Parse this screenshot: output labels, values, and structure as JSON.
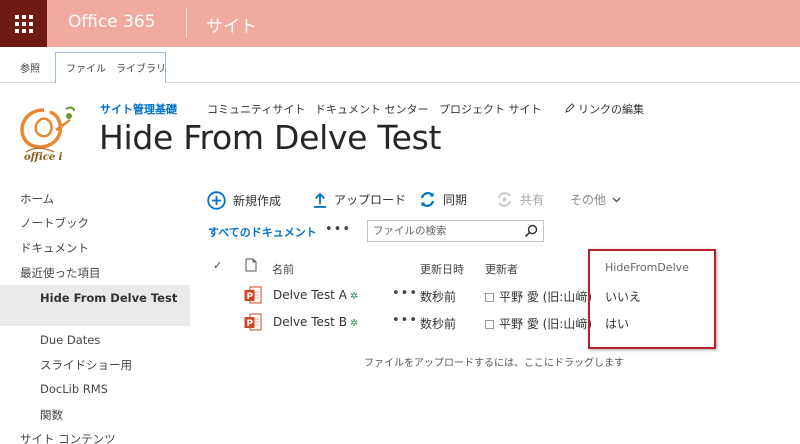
{
  "suite": {
    "brand": "Office 365",
    "site": "サイト"
  },
  "ribbon": {
    "tabs": [
      "参照",
      "ファイル",
      "ライブラリ"
    ]
  },
  "topnav": {
    "items": [
      "サイト管理基礎",
      "コミュニティサイト",
      "ドキュメント センター",
      "プロジェクト サイト"
    ],
    "edit_links": "リンクの編集"
  },
  "site_title": "Hide From Delve Test",
  "leftnav": {
    "items": [
      "ホーム",
      "ノートブック",
      "ドキュメント",
      "最近使った項目"
    ],
    "recent": [
      "Hide From Delve Test",
      "Due Dates",
      "スライドショー用",
      "DocLib RMS",
      "関数"
    ],
    "site_contents": "サイト コンテンツ"
  },
  "commands": {
    "new": "新規作成",
    "upload": "アップロード",
    "sync": "同期",
    "share": "共有",
    "more": "その他"
  },
  "view": {
    "name": "すべてのドキュメント",
    "ellipsis": "•••",
    "search_placeholder": "ファイルの検索"
  },
  "table": {
    "columns": {
      "check": "✓",
      "name": "名前",
      "modified": "更新日時",
      "modified_by": "更新者",
      "hide": "HideFromDelve"
    },
    "rows": [
      {
        "name": "Delve Test A",
        "new_marker": "✲",
        "ellipsis": "•••",
        "modified": "数秒前",
        "modified_by": "平野 愛 (旧:山﨑)",
        "hide": "いいえ"
      },
      {
        "name": "Delve Test B",
        "new_marker": "✲",
        "ellipsis": "•••",
        "modified": "数秒前",
        "modified_by": "平野 愛 (旧:山﨑)",
        "hide": "はい"
      }
    ],
    "drag_hint": "ファイルをアップロードするには、ここにドラッグします"
  },
  "colors": {
    "suite_bar": "#f1aa9d",
    "waffle": "#6e1a10",
    "accent": "#0072c6",
    "highlight_box": "#b8202b"
  }
}
